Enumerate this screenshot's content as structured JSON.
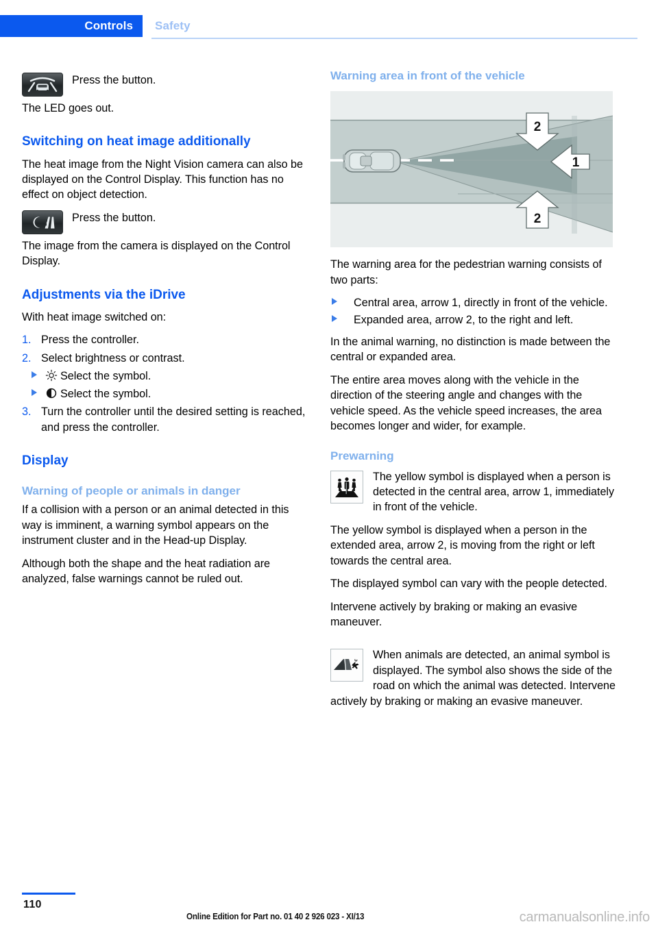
{
  "header": {
    "tab_active": "Controls",
    "tab_inactive": "Safety",
    "accent_color": "#0b59ee",
    "inactive_color": "#9dc0f5"
  },
  "left_column": {
    "press_button_1": "Press the button.",
    "led_goes_out": "The LED goes out.",
    "heading_switching": "Switching on heat image additionally",
    "para_heat_image": "The heat image from the Night Vision camera can also be displayed on the Control Display. This function has no effect on object detection.",
    "press_button_2": "Press the button.",
    "para_camera_image": "The image from the camera is displayed on the Control Display.",
    "heading_adjustments": "Adjustments via the iDrive",
    "para_with_heat": "With heat image switched on:",
    "steps": [
      {
        "num": "1.",
        "text": "Press the controller."
      },
      {
        "num": "2.",
        "text": "Select brightness or contrast."
      },
      {
        "num": "3.",
        "text": "Turn the controller until the desired setting is reached, and press the controller."
      }
    ],
    "sub_steps": [
      {
        "symbol": "brightness-sun-symbol",
        "text": "Select the symbol."
      },
      {
        "symbol": "contrast-half-circle-symbol",
        "text": "Select the symbol."
      }
    ],
    "heading_display": "Display",
    "heading_warning_people": "Warning of people or animals in danger",
    "para_collision": "If a collision with a person or an animal detected in this way is imminent, a warning symbol appears on the instrument cluster and in the Head-up Display.",
    "para_although": "Although both the shape and the heat radiation are analyzed, false warnings cannot be ruled out."
  },
  "right_column": {
    "heading_warning_area": "Warning area in front of the vehicle",
    "para_warning_area": "The warning area for the pedestrian warning consists of two parts:",
    "bullets": [
      "Central area, arrow 1, directly in front of the vehicle.",
      "Expanded area, arrow 2, to the right and left."
    ],
    "para_animal_warning": "In the animal warning, no distinction is made between the central or expanded area.",
    "para_entire_area": "The entire area moves along with the vehicle in the direction of the steering angle and changes with the vehicle speed. As the vehicle speed increases, the area becomes longer and wider, for example.",
    "heading_prewarning": "Prewarning",
    "para_yellow_central": "The yellow symbol is displayed when a person is detected in the central area, arrow 1, immediately in front of the vehicle.",
    "para_yellow_extended": "The yellow symbol is displayed when a person in the extended area, arrow 2, is moving from the right or left towards the central area.",
    "para_symbol_vary": "The displayed symbol can vary with the people detected.",
    "para_intervene": "Intervene actively by braking or making an evasive maneuver.",
    "para_animals": "When animals are detected, an animal symbol is displayed. The symbol also shows the side of the road on which the animal was detected. Intervene actively by braking or making an evasive maneuver."
  },
  "figure": {
    "name": "warning-area-diagram",
    "arrow_labels": [
      "2",
      "1",
      "2"
    ],
    "road_color": "#c3cfce",
    "background_color": "#eaeeee",
    "central_area_color": "#8fa3a2",
    "expanded_area_color": "#b2c0bf"
  },
  "icons": {
    "night_vision_button": "night-vision-button-icon",
    "heat_image_button": "heat-image-button-icon",
    "pedestrian_warning": "pedestrian-warning-icon",
    "animal_warning": "animal-warning-icon"
  },
  "footer": {
    "page_number": "110",
    "edition": "Online Edition for Part no. 01 40 2 926 023 - XI/13",
    "watermark": "carmanualsonline.info"
  }
}
